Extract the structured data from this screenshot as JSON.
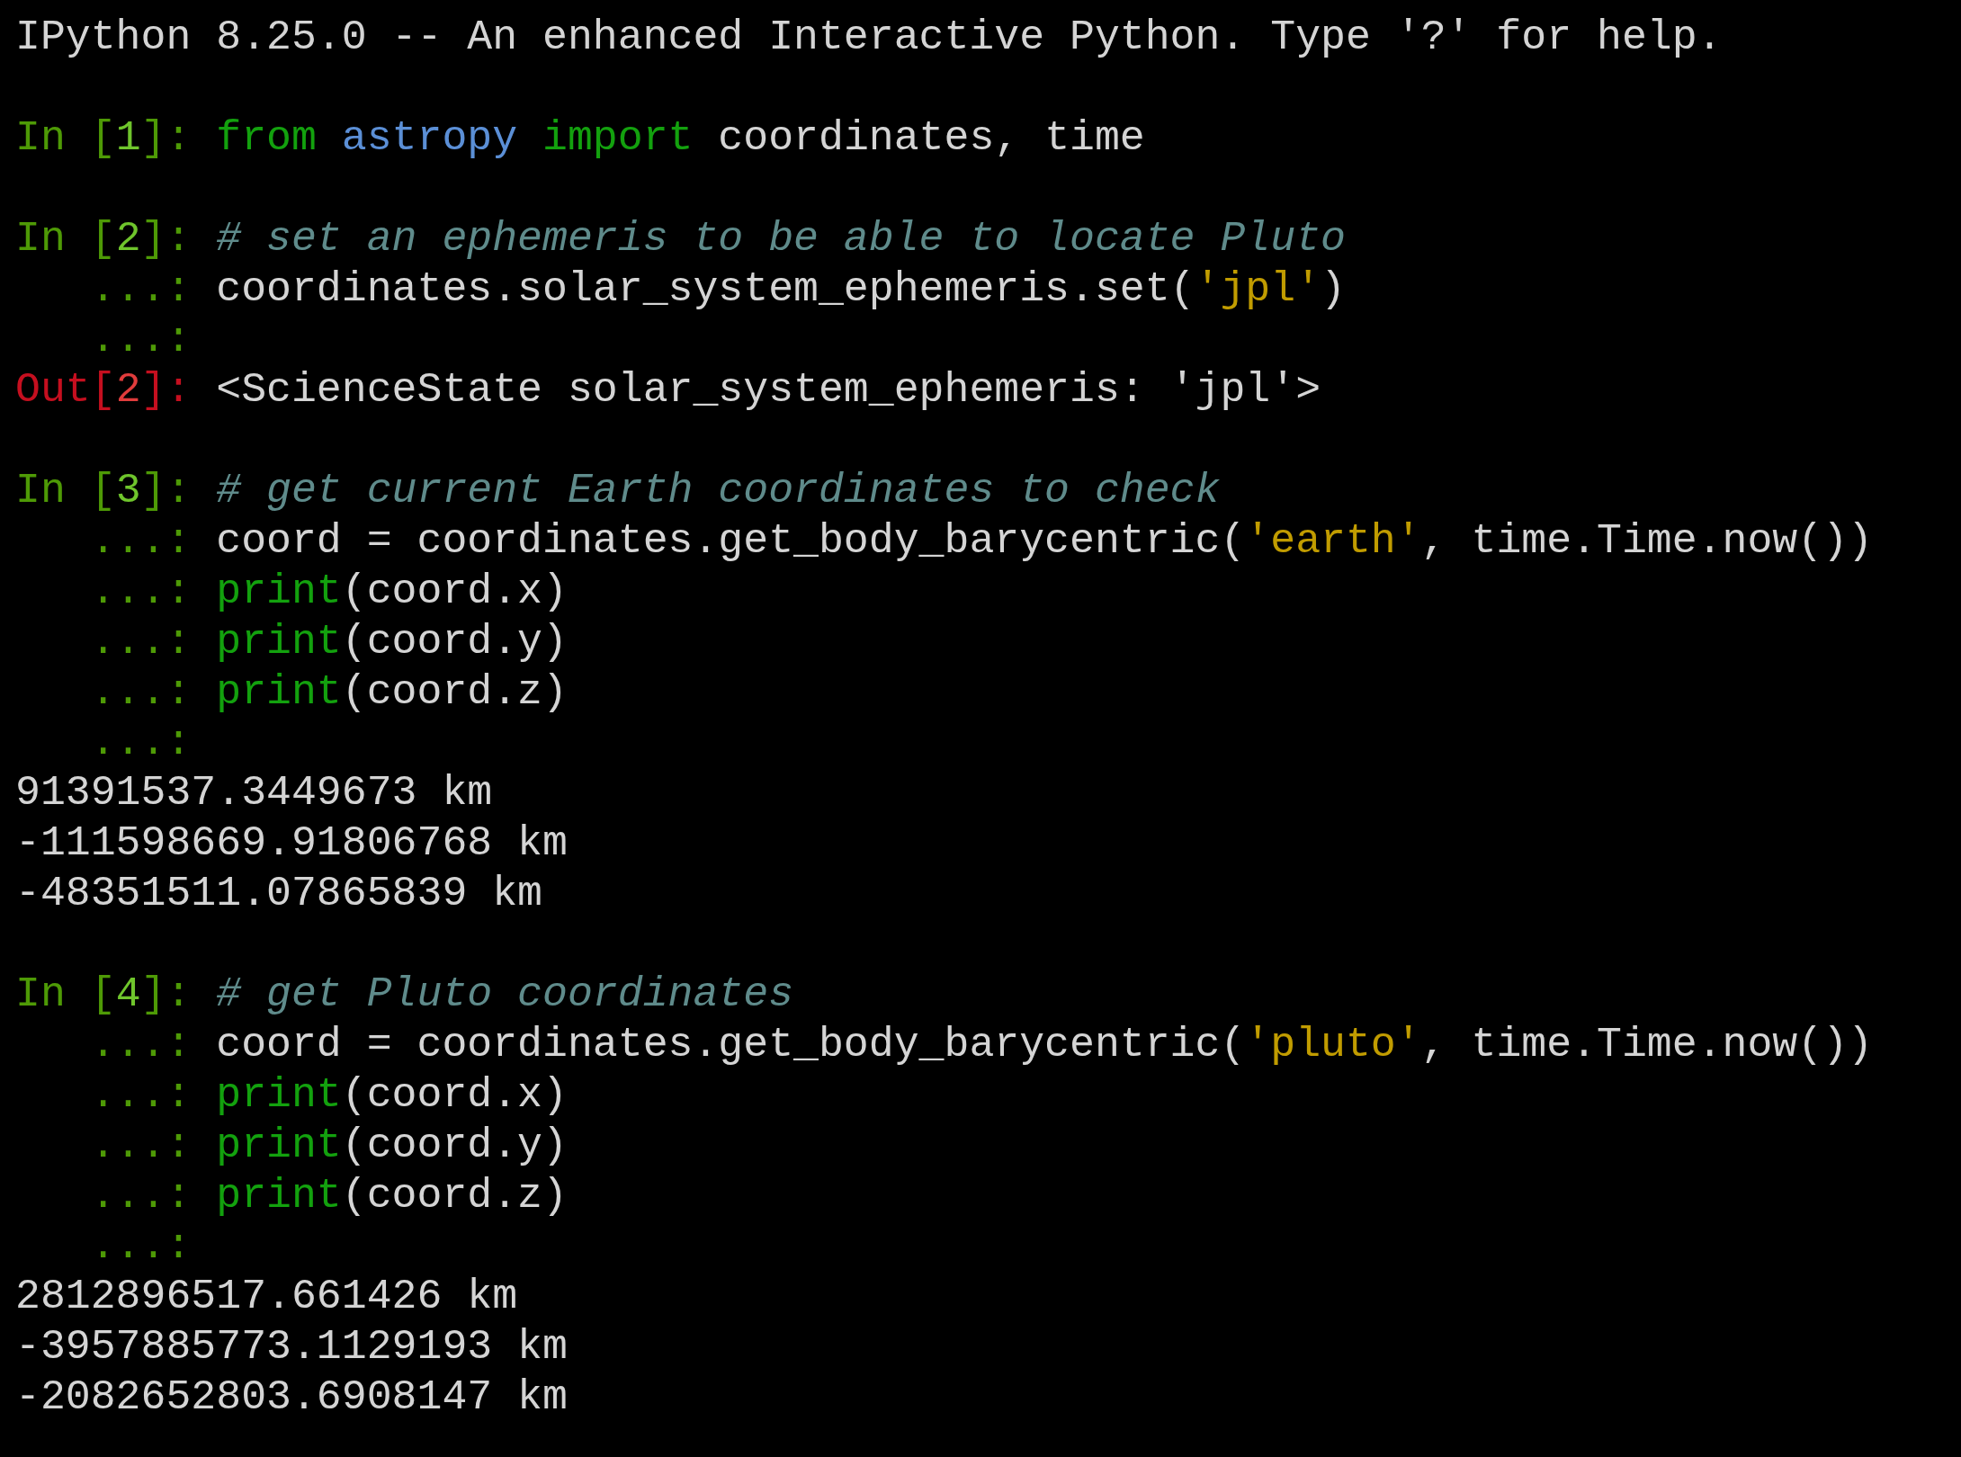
{
  "terminal": {
    "lines": [
      {
        "kind": "text",
        "segments": [
          {
            "kind": "plain",
            "text": "IPython 8.25.0 -- An enhanced Interactive Python. Type '?' for help."
          }
        ]
      },
      {
        "kind": "blank"
      },
      {
        "kind": "text",
        "segments": [
          {
            "kind": "in",
            "text": "In ["
          },
          {
            "kind": "in-num",
            "text": "1"
          },
          {
            "kind": "in",
            "text": "]: "
          },
          {
            "kind": "keyword",
            "text": "from "
          },
          {
            "kind": "module",
            "text": "astropy "
          },
          {
            "kind": "keyword",
            "text": "import"
          },
          {
            "kind": "plain",
            "text": " coordinates, time"
          }
        ]
      },
      {
        "kind": "blank"
      },
      {
        "kind": "text",
        "segments": [
          {
            "kind": "in",
            "text": "In ["
          },
          {
            "kind": "in-num",
            "text": "2"
          },
          {
            "kind": "in",
            "text": "]: "
          },
          {
            "kind": "comment",
            "text": "# set an ephemeris to be able to locate Pluto"
          }
        ]
      },
      {
        "kind": "text",
        "segments": [
          {
            "kind": "in",
            "text": "   ...: "
          },
          {
            "kind": "plain",
            "text": "coordinates.solar_system_ephemeris.set("
          },
          {
            "kind": "string",
            "text": "'jpl'"
          },
          {
            "kind": "plain",
            "text": ")"
          }
        ]
      },
      {
        "kind": "text",
        "segments": [
          {
            "kind": "in",
            "text": "   ...:"
          }
        ]
      },
      {
        "kind": "text",
        "segments": [
          {
            "kind": "out",
            "text": "Out["
          },
          {
            "kind": "out-num",
            "text": "2"
          },
          {
            "kind": "out",
            "text": "]: "
          },
          {
            "kind": "plain",
            "text": "<ScienceState solar_system_ephemeris: 'jpl'>"
          }
        ]
      },
      {
        "kind": "blank"
      },
      {
        "kind": "text",
        "segments": [
          {
            "kind": "in",
            "text": "In ["
          },
          {
            "kind": "in-num",
            "text": "3"
          },
          {
            "kind": "in",
            "text": "]: "
          },
          {
            "kind": "comment",
            "text": "# get current Earth coordinates to check"
          }
        ]
      },
      {
        "kind": "text",
        "segments": [
          {
            "kind": "in",
            "text": "   ...: "
          },
          {
            "kind": "plain",
            "text": "coord = coordinates.get_body_barycentric("
          },
          {
            "kind": "string",
            "text": "'earth'"
          },
          {
            "kind": "plain",
            "text": ", time.Time.now())"
          }
        ]
      },
      {
        "kind": "text",
        "segments": [
          {
            "kind": "in",
            "text": "   ...: "
          },
          {
            "kind": "keyword",
            "text": "print"
          },
          {
            "kind": "plain",
            "text": "(coord.x)"
          }
        ]
      },
      {
        "kind": "text",
        "segments": [
          {
            "kind": "in",
            "text": "   ...: "
          },
          {
            "kind": "keyword",
            "text": "print"
          },
          {
            "kind": "plain",
            "text": "(coord.y)"
          }
        ]
      },
      {
        "kind": "text",
        "segments": [
          {
            "kind": "in",
            "text": "   ...: "
          },
          {
            "kind": "keyword",
            "text": "print"
          },
          {
            "kind": "plain",
            "text": "(coord.z)"
          }
        ]
      },
      {
        "kind": "text",
        "segments": [
          {
            "kind": "in",
            "text": "   ...:"
          }
        ]
      },
      {
        "kind": "text",
        "segments": [
          {
            "kind": "plain",
            "text": "91391537.3449673 km"
          }
        ]
      },
      {
        "kind": "text",
        "segments": [
          {
            "kind": "plain",
            "text": "-111598669.91806768 km"
          }
        ]
      },
      {
        "kind": "text",
        "segments": [
          {
            "kind": "plain",
            "text": "-48351511.07865839 km"
          }
        ]
      },
      {
        "kind": "blank"
      },
      {
        "kind": "text",
        "segments": [
          {
            "kind": "in",
            "text": "In ["
          },
          {
            "kind": "in-num",
            "text": "4"
          },
          {
            "kind": "in",
            "text": "]: "
          },
          {
            "kind": "comment",
            "text": "# get Pluto coordinates"
          }
        ]
      },
      {
        "kind": "text",
        "segments": [
          {
            "kind": "in",
            "text": "   ...: "
          },
          {
            "kind": "plain",
            "text": "coord = coordinates.get_body_barycentric("
          },
          {
            "kind": "string",
            "text": "'pluto'"
          },
          {
            "kind": "plain",
            "text": ", time.Time.now())"
          }
        ]
      },
      {
        "kind": "text",
        "segments": [
          {
            "kind": "in",
            "text": "   ...: "
          },
          {
            "kind": "keyword",
            "text": "print"
          },
          {
            "kind": "plain",
            "text": "(coord.x)"
          }
        ]
      },
      {
        "kind": "text",
        "segments": [
          {
            "kind": "in",
            "text": "   ...: "
          },
          {
            "kind": "keyword",
            "text": "print"
          },
          {
            "kind": "plain",
            "text": "(coord.y)"
          }
        ]
      },
      {
        "kind": "text",
        "segments": [
          {
            "kind": "in",
            "text": "   ...: "
          },
          {
            "kind": "keyword",
            "text": "print"
          },
          {
            "kind": "plain",
            "text": "(coord.z)"
          }
        ]
      },
      {
        "kind": "text",
        "segments": [
          {
            "kind": "in",
            "text": "   ...:"
          }
        ]
      },
      {
        "kind": "text",
        "segments": [
          {
            "kind": "plain",
            "text": "2812896517.661426 km"
          }
        ]
      },
      {
        "kind": "text",
        "segments": [
          {
            "kind": "plain",
            "text": "-3957885773.1129193 km"
          }
        ]
      },
      {
        "kind": "text",
        "segments": [
          {
            "kind": "plain",
            "text": "-2082652803.6908147 km"
          }
        ]
      }
    ]
  }
}
